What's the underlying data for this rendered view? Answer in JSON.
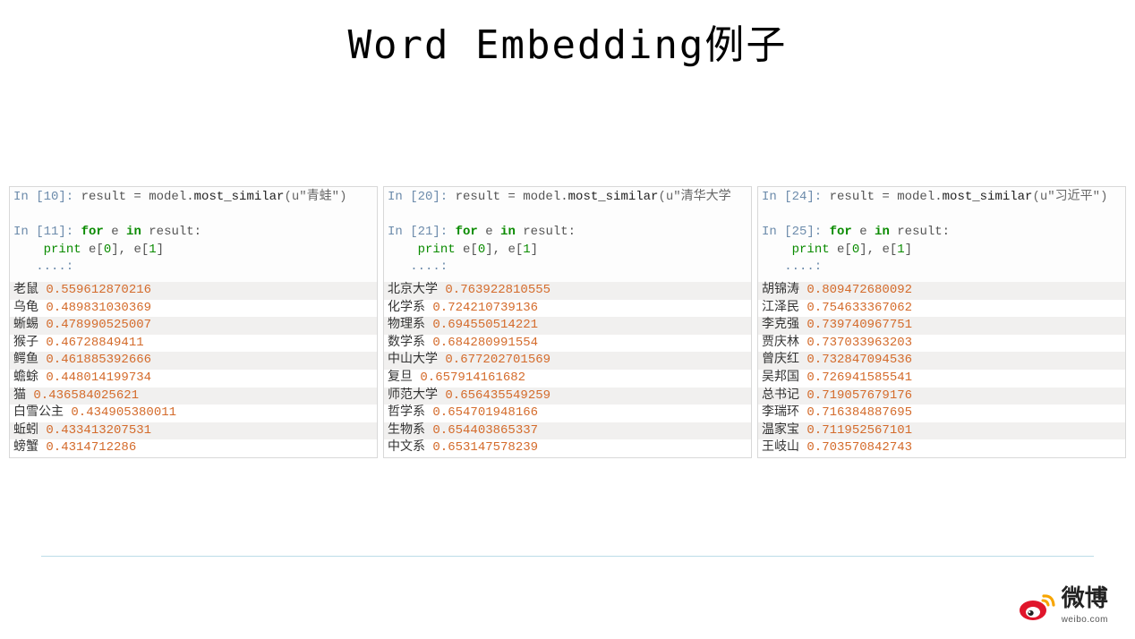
{
  "title": "Word Embedding例子",
  "panels": [
    {
      "call_prompt": "In [10]:",
      "call_expr_left": " result = model.",
      "call_method": "most_similar",
      "call_arg": "(u\"青蛙\")",
      "loop_prompt": "In [11]:",
      "loop_kw_for": " for",
      "loop_var": " e ",
      "loop_kw_in": "in",
      "loop_rest": " result:",
      "print_indent": "    ",
      "print_kw": "print",
      "print_expr1": " e[",
      "print_idx0": "0",
      "print_mid": "], e[",
      "print_idx1": "1",
      "print_end": "]",
      "dots": "   ....:",
      "rows": [
        {
          "word": "老鼠",
          "score": "0.559612870216"
        },
        {
          "word": "乌龟",
          "score": "0.489831030369"
        },
        {
          "word": "蜥蜴",
          "score": "0.478990525007"
        },
        {
          "word": "猴子",
          "score": "0.46728849411"
        },
        {
          "word": "鳄鱼",
          "score": "0.461885392666"
        },
        {
          "word": "蟾蜍",
          "score": "0.448014199734"
        },
        {
          "word": "猫",
          "score": "0.436584025621"
        },
        {
          "word": "白雪公主",
          "score": "0.434905380011"
        },
        {
          "word": "蚯蚓",
          "score": "0.433413207531"
        },
        {
          "word": "螃蟹",
          "score": "0.4314712286"
        }
      ]
    },
    {
      "call_prompt": "In [20]:",
      "call_expr_left": " result = model.",
      "call_method": "most_similar",
      "call_arg": "(u\"清华大学",
      "loop_prompt": "In [21]:",
      "loop_kw_for": " for",
      "loop_var": " e ",
      "loop_kw_in": "in",
      "loop_rest": " result:",
      "print_indent": "    ",
      "print_kw": "print",
      "print_expr1": " e[",
      "print_idx0": "0",
      "print_mid": "], e[",
      "print_idx1": "1",
      "print_end": "]",
      "dots": "   ....:",
      "rows": [
        {
          "word": "北京大学",
          "score": "0.763922810555"
        },
        {
          "word": "化学系",
          "score": "0.724210739136"
        },
        {
          "word": "物理系",
          "score": "0.694550514221"
        },
        {
          "word": "数学系",
          "score": "0.684280991554"
        },
        {
          "word": "中山大学",
          "score": "0.677202701569"
        },
        {
          "word": "复旦",
          "score": "0.657914161682"
        },
        {
          "word": "师范大学",
          "score": "0.656435549259"
        },
        {
          "word": "哲学系",
          "score": "0.654701948166"
        },
        {
          "word": "生物系",
          "score": "0.654403865337"
        },
        {
          "word": "中文系",
          "score": "0.653147578239"
        }
      ]
    },
    {
      "call_prompt": "In [24]:",
      "call_expr_left": " result = model.",
      "call_method": "most_similar",
      "call_arg": "(u\"习近平\")",
      "loop_prompt": "In [25]:",
      "loop_kw_for": " for",
      "loop_var": " e ",
      "loop_kw_in": "in",
      "loop_rest": " result:",
      "print_indent": "    ",
      "print_kw": "print",
      "print_expr1": " e[",
      "print_idx0": "0",
      "print_mid": "], e[",
      "print_idx1": "1",
      "print_end": "]",
      "dots": "   ....:",
      "rows": [
        {
          "word": "胡锦涛",
          "score": "0.809472680092"
        },
        {
          "word": "江泽民",
          "score": "0.754633367062"
        },
        {
          "word": "李克强",
          "score": "0.739740967751"
        },
        {
          "word": "贾庆林",
          "score": "0.737033963203"
        },
        {
          "word": "曾庆红",
          "score": "0.732847094536"
        },
        {
          "word": "吴邦国",
          "score": "0.726941585541"
        },
        {
          "word": "总书记",
          "score": "0.719057679176"
        },
        {
          "word": "李瑞环",
          "score": "0.716384887695"
        },
        {
          "word": "温家宝",
          "score": "0.711952567101"
        },
        {
          "word": "王岐山",
          "score": "0.703570842743"
        }
      ]
    }
  ],
  "logo": {
    "text": "微博",
    "sub": "weibo.com"
  }
}
